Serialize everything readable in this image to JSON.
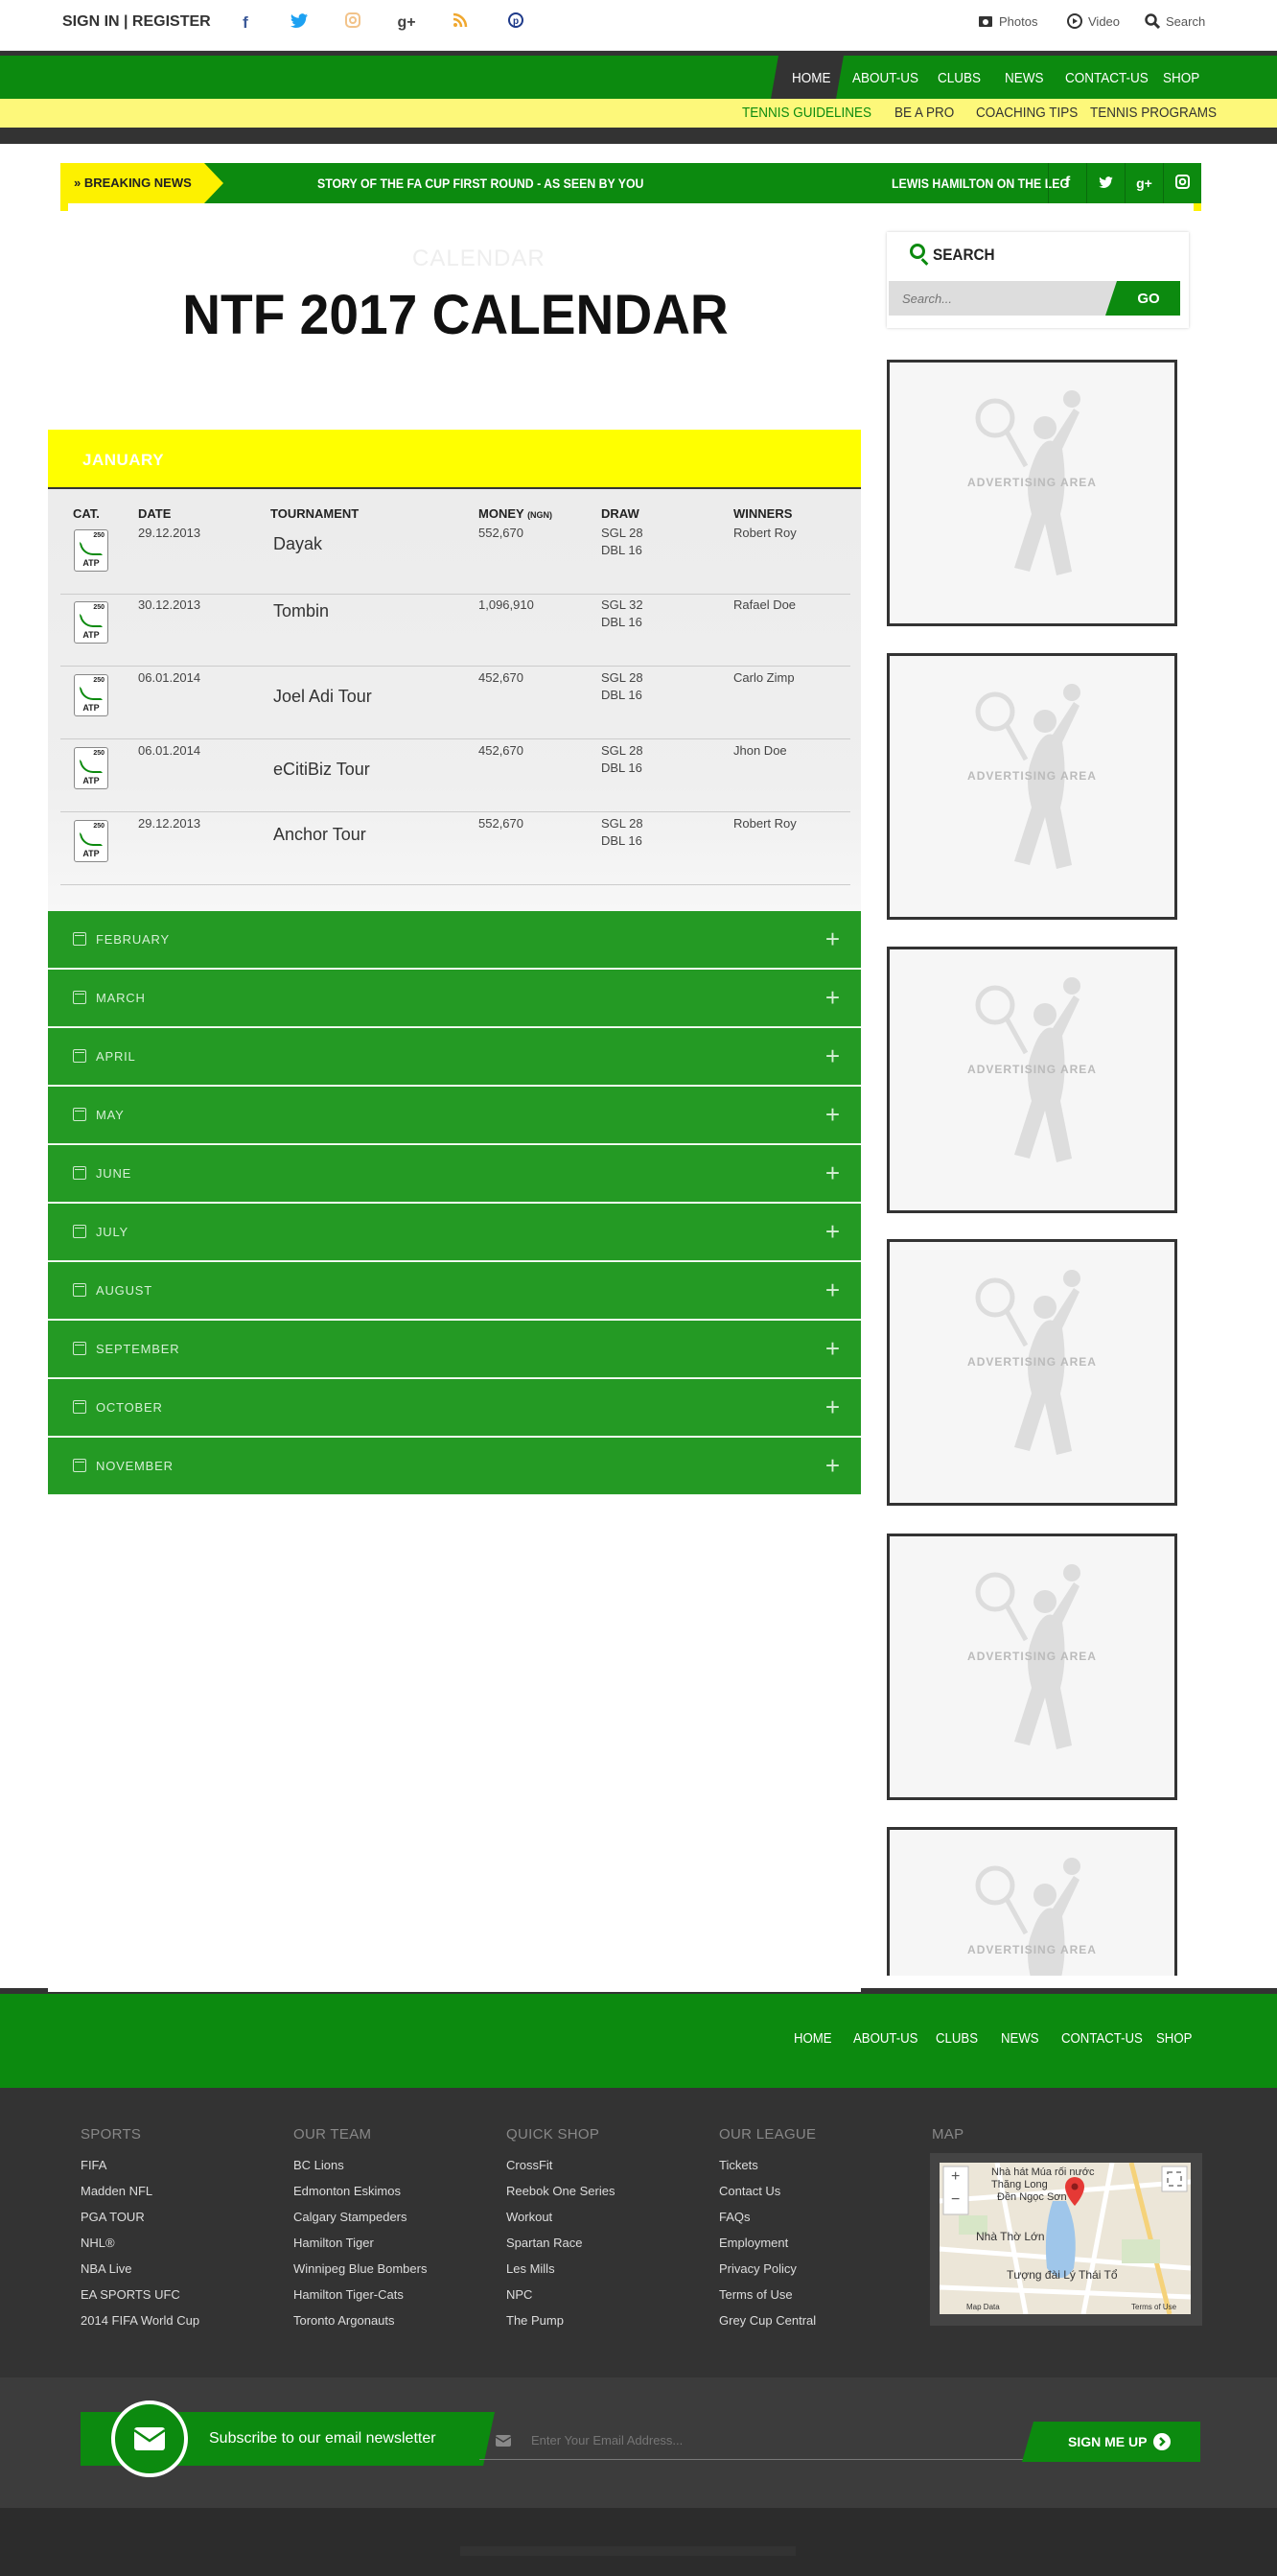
{
  "topbar": {
    "signin": "SIGN IN | REGISTER",
    "tools": {
      "photos": "Photos",
      "video": "Video",
      "search": "Search"
    }
  },
  "colors": {
    "green": "#0c8a0f",
    "yellow": "#fdf100",
    "dark": "#333333"
  },
  "nav": {
    "main": [
      "HOME",
      "ABOUT-US",
      "CLUBS",
      "NEWS",
      "CONTACT-US",
      "SHOP"
    ],
    "sub": [
      "TENNIS GUIDELINES",
      "BE A PRO",
      "COACHING TIPS",
      "TENNIS PROGRAMS"
    ]
  },
  "breaking": {
    "label": "BREAKING NEWS",
    "items": [
      "STORY OF THE FA CUP FIRST ROUND - AS SEEN BY YOU",
      "LEWIS HAMILTON ON THE LEG"
    ]
  },
  "page": {
    "ghost_title": "CALENDAR",
    "title": "NTF 2017 CALENDAR"
  },
  "calendar": {
    "open_month": "JANUARY",
    "columns": {
      "cat": "CAT.",
      "date": "DATE",
      "tournament": "TOURNAMENT",
      "money": "MONEY",
      "money_unit": "(NGN)",
      "draw": "DRAW",
      "winners": "WINNERS"
    },
    "badge": {
      "num": "250",
      "tour": "ATP"
    },
    "rows": [
      {
        "date": "29.12.2013",
        "tournament": "Dayak",
        "money": "552,670",
        "sgl": "SGL 28",
        "dbl": "DBL 16",
        "winner": "Robert Roy"
      },
      {
        "date": "30.12.2013",
        "tournament": "Tombin",
        "money": "1,096,910",
        "sgl": "SGL 32",
        "dbl": "DBL 16",
        "winner": "Rafael Doe"
      },
      {
        "date": "06.01.2014",
        "tournament": "Joel Adi Tour",
        "money": "452,670",
        "sgl": "SGL 28",
        "dbl": "DBL 16",
        "winner": "Carlo Zimp"
      },
      {
        "date": "06.01.2014",
        "tournament": "eCitiBiz Tour",
        "money": "452,670",
        "sgl": "SGL 28",
        "dbl": "DBL 16",
        "winner": "Jhon Doe"
      },
      {
        "date": "29.12.2013",
        "tournament": "Anchor Tour",
        "money": "552,670",
        "sgl": "SGL 28",
        "dbl": "DBL 16",
        "winner": "Robert Roy"
      }
    ],
    "collapsed_months": [
      "FEBRUARY",
      "MARCH",
      "APRIL",
      "MAY",
      "JUNE",
      "JULY",
      "AUGUST",
      "SEPTEMBER",
      "OCTOBER",
      "NOVEMBER"
    ]
  },
  "sidebar": {
    "search_title": "SEARCH",
    "search_placeholder": "Search...",
    "go": "GO",
    "ad_label": "ADVERTISING AREA"
  },
  "footer": {
    "nav": [
      "HOME",
      "ABOUT-US",
      "CLUBS",
      "NEWS",
      "CONTACT-US",
      "SHOP"
    ],
    "columns": [
      {
        "title": "SPORTS",
        "items": [
          "FIFA",
          "Madden NFL",
          "PGA TOUR",
          "NHL®",
          "NBA Live",
          "EA SPORTS UFC",
          "2014 FIFA World Cup"
        ]
      },
      {
        "title": "OUR TEAM",
        "items": [
          "BC Lions",
          "Edmonton Eskimos",
          "Calgary Stampeders",
          "Hamilton Tiger",
          "Winnipeg Blue Bombers",
          "Hamilton Tiger-Cats",
          "Toronto Argonauts"
        ]
      },
      {
        "title": "QUICK SHOP",
        "items": [
          "CrossFit",
          "Reebok One Series",
          "Workout",
          "Spartan Race",
          "Les Mills",
          "NPC",
          "The Pump"
        ]
      },
      {
        "title": "OUR LEAGUE",
        "items": [
          "Tickets",
          "Contact Us",
          "FAQs",
          "Employment",
          "Privacy Policy",
          "Terms of Use",
          "Grey Cup Central"
        ]
      }
    ],
    "map_title": "MAP",
    "map_labels": {
      "a": "Nhà hát Múa rối nước Thăng Long",
      "b": "Đền Ngọc Sơn",
      "c": "Nhà Thờ Lớn",
      "d": "Tượng đài Lý Thái Tổ",
      "data": "Map Data",
      "terms": "Terms of Use",
      "plus": "+",
      "minus": "−"
    },
    "newsletter": {
      "text": "Subscribe to our email newsletter",
      "placeholder": "Enter Your Email Address...",
      "button": "SIGN ME UP"
    }
  }
}
